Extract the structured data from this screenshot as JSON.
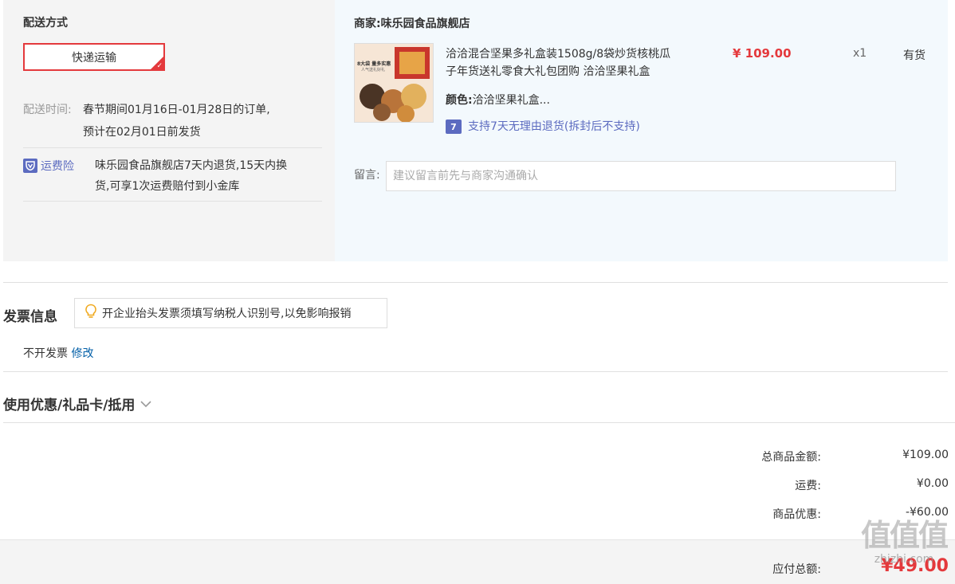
{
  "shipping": {
    "title": "配送方式",
    "option": "快递运输",
    "time_label": "配送时间:",
    "time_line1": "春节期间01月16日-01月28日的订单,",
    "time_line2": "预计在02月01日前发货",
    "freight_icon": "shield-icon",
    "freight_label": "运费险",
    "freight_line1": "味乐园食品旗舰店7天内退货,15天内换",
    "freight_line2": "货,可享1次运费赔付到小金库"
  },
  "merchant": {
    "label": "商家:",
    "name": "味乐园食品旗舰店",
    "product": {
      "title_line1": "洽洽混合坚果多礼盒装1508g/8袋炒货核桃瓜",
      "title_line2": "子年货送礼零食大礼包团购 洽洽坚果礼盒",
      "price": "¥ 109.00",
      "quantity": "x1",
      "stock": "有货",
      "color_label": "颜色:",
      "color_value": "洽洽坚果礼盒...",
      "return_icon_text": "7",
      "return_policy": "支持7天无理由退货(拆封后不支持)",
      "image_text_line1": "8大袋 量多实惠",
      "image_text_line2": "人气送礼好礼"
    },
    "remark_label": "留言:",
    "remark_placeholder": "建议留言前先与商家沟通确认"
  },
  "invoice": {
    "title": "发票信息",
    "tip_icon": "lightbulb-icon",
    "tip": "开企业抬头发票须填写纳税人识别号,以免影响报销",
    "status": "不开发票",
    "modify": "修改"
  },
  "coupon": {
    "title": "使用优惠/礼品卡/抵用",
    "icon": "chevron-down-icon"
  },
  "summary": {
    "goods_label": "总商品金额:",
    "goods_value": "¥109.00",
    "shipping_label": "运费:",
    "shipping_value": "¥0.00",
    "discount_label": "商品优惠:",
    "discount_value": "-¥60.00",
    "total_label": "应付总额:",
    "total_value": "¥49.00"
  },
  "watermark": {
    "logo": "值值值",
    "site": "zhizhi.com"
  },
  "colors": {
    "accent": "#e4393c",
    "link": "#005ea7",
    "badge": "#5c6bc0",
    "right_panel_bg": "#f3f9fd",
    "left_panel_bg": "#f4f4f4"
  }
}
